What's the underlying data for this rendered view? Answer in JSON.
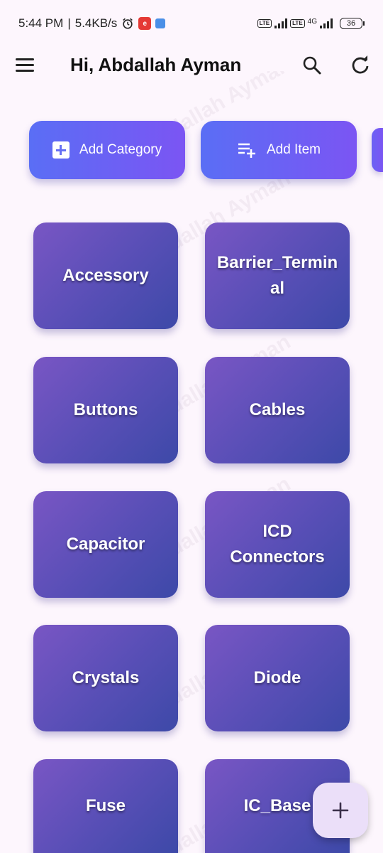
{
  "status_bar": {
    "time": "5:44 PM",
    "separator": "|",
    "speed": "5.4KB/s",
    "volte_label": "Vo LTE",
    "network_type": "4G",
    "battery": "36"
  },
  "app_bar": {
    "title": "Hi, Abdallah Ayman",
    "menu_icon": "menu-icon",
    "search_icon": "search-icon",
    "refresh_icon": "refresh-icon"
  },
  "watermark": {
    "text": "Abdallah Ayman"
  },
  "actions": {
    "add_category": {
      "label": "Add Category",
      "icon": "add-box-icon"
    },
    "add_item": {
      "label": "Add Item",
      "icon": "playlist-add-icon"
    }
  },
  "categories": [
    "Accessory",
    "Barrier_Terminal",
    "Buttons",
    "Cables",
    "Capacitor",
    "ICD Connectors",
    "Crystals",
    "Diode",
    "Fuse",
    "IC_Base"
  ],
  "fab": {
    "icon": "add-icon"
  },
  "colors": {
    "background": "#fdf6fd",
    "action_gradient_start": "#5a6ef5",
    "action_gradient_end": "#7b55f3",
    "card_gradient_start": "#7956c4",
    "card_gradient_end": "#3d49a8",
    "fab_background": "#ebdff9"
  }
}
